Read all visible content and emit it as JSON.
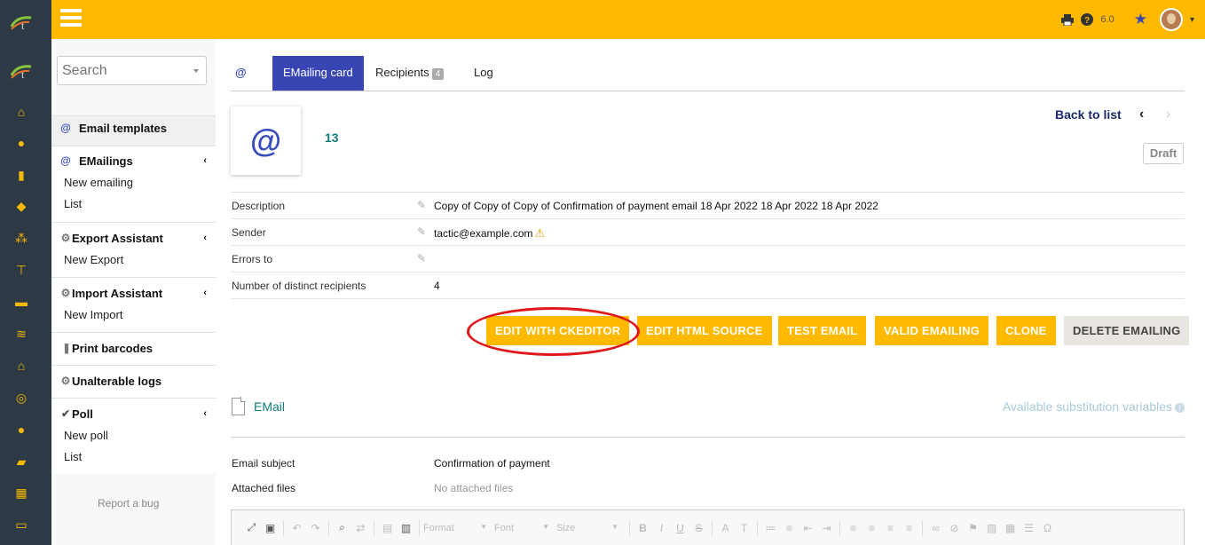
{
  "topbar": {
    "version": "6.0"
  },
  "sidebar": {
    "search_placeholder": "Search",
    "email_templates": "Email templates",
    "emailings": {
      "title": "EMailings",
      "items": [
        "New emailing",
        "List"
      ]
    },
    "export_assistant": {
      "title": "Export Assistant",
      "items": [
        "New Export"
      ]
    },
    "import_assistant": {
      "title": "Import Assistant",
      "items": [
        "New Import"
      ]
    },
    "print_barcodes": "Print barcodes",
    "unalterable_logs": "Unalterable logs",
    "poll": {
      "title": "Poll",
      "items": [
        "New poll",
        "List"
      ]
    },
    "report_bug": "Report a bug"
  },
  "tabs": {
    "at": "@",
    "card": "EMailing card",
    "recipients": "Recipients",
    "recipients_count": "4",
    "log": "Log"
  },
  "card": {
    "icon_glyph": "@",
    "ref": "13",
    "back_to_list": "Back to list",
    "status": "Draft"
  },
  "fields": [
    {
      "label": "Description",
      "value": "Copy of Copy of Copy of Confirmation of payment email 18 Apr 2022 18 Apr 2022 18 Apr 2022"
    },
    {
      "label": "Sender",
      "value": "tactic@example.com"
    },
    {
      "label": "Errors to",
      "value": ""
    },
    {
      "label": "Number of distinct recipients",
      "value": "4"
    }
  ],
  "buttons": [
    "EDIT WITH CKEDITOR",
    "EDIT HTML SOURCE",
    "TEST EMAIL",
    "VALID EMAILING",
    "CLONE",
    "DELETE EMAILING"
  ],
  "email_section": {
    "label": "EMail",
    "substitution_vars": "Available substitution variables",
    "subject_label": "Email subject",
    "subject_value": "Confirmation of payment",
    "attached_label": "Attached files",
    "attached_value": "No attached files"
  },
  "editor_toolbar": {
    "format": "Format",
    "font": "Font",
    "size": "Size"
  },
  "colors": {
    "accent": "#ffba00",
    "sidebar_dark": "#2d3a46",
    "tab_active": "#3846b4",
    "teal": "#0e7c7b",
    "highlight_circle": "#e0181c"
  }
}
